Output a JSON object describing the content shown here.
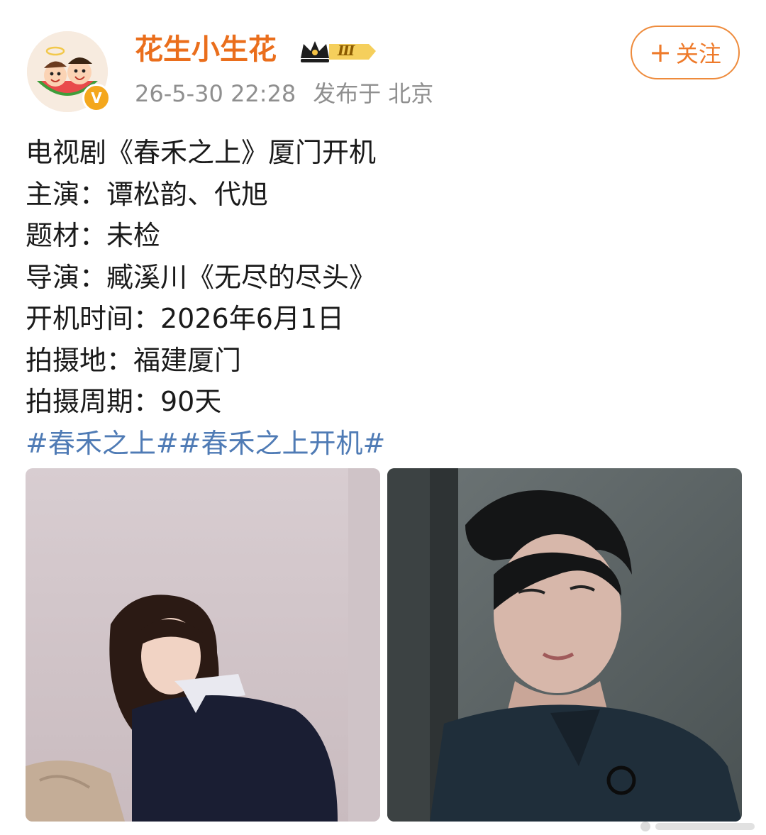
{
  "post": {
    "author": {
      "username": "花生小生花",
      "verified_badge": "V",
      "vip_level_label": "Ⅲ",
      "avatar_icon": "watermelon-cartoon-avatar",
      "vip_icon": "crown-icon"
    },
    "timestamp": "26-5-30 22:28",
    "location_label": "发布于",
    "location": "北京",
    "follow_button": {
      "plus": "+",
      "label": "关注"
    },
    "content": {
      "lines": [
        "电视剧《春禾之上》厦门开机",
        "主演：谭松韵、代旭",
        "题材：未检",
        "导演：臧溪川《无尽的尽头》",
        "开机时间：2026年6月1日",
        "拍摄地：福建厦门",
        "拍摄周期：90天"
      ],
      "hashtags": "#春禾之上##春禾之上开机#"
    },
    "images": [
      {
        "name": "actress-photo"
      },
      {
        "name": "actor-photo"
      }
    ]
  },
  "colors": {
    "username": "#ea6e1c",
    "follow_border": "#ee8b3c",
    "hashtag": "#4f7bb5",
    "meta_text": "#8f8f8f",
    "verified_badge": "#f4a71d"
  }
}
